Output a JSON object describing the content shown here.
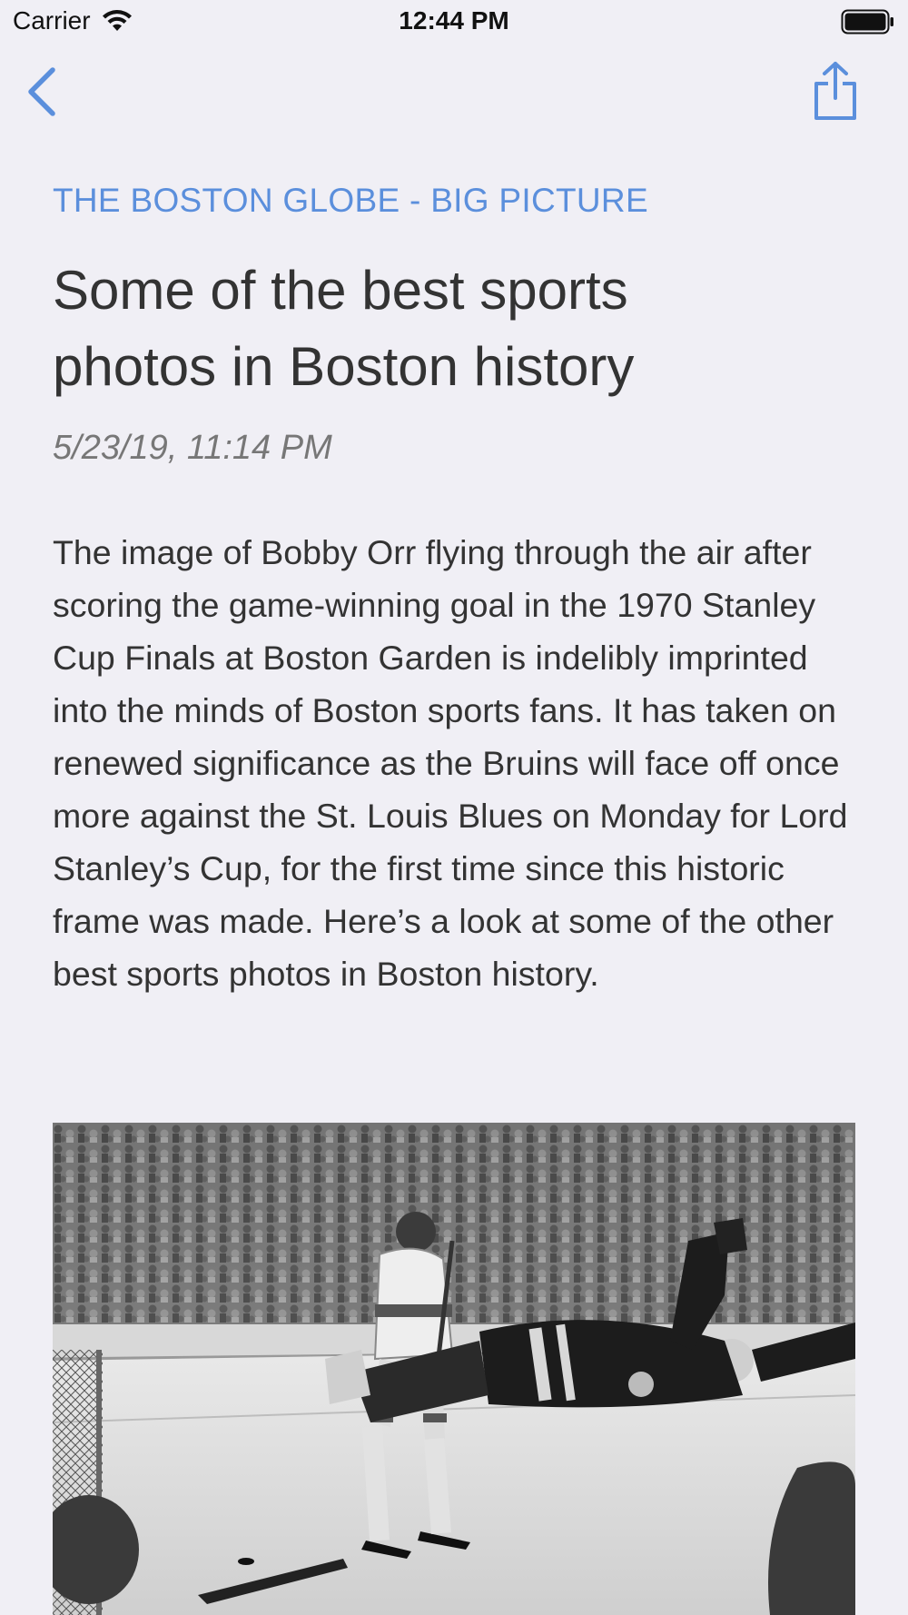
{
  "status_bar": {
    "carrier": "Carrier",
    "time": "12:44 PM"
  },
  "nav": {
    "back_icon": "chevron-left-icon",
    "share_icon": "share-icon",
    "accent_color": "#5b8fdc"
  },
  "article": {
    "source": "THE BOSTON GLOBE - BIG PICTURE",
    "title": "Some of the best sports photos in Boston history",
    "date": "5/23/19, 11:14 PM",
    "body": "The image of Bobby Orr flying through the air after scoring the game-winning goal in the 1970 Stanley Cup Finals at Boston Garden is indelibly imprinted into the minds of Boston sports fans. It has taken on renewed significance as the Bruins will face off once more against the St. Louis Blues on Monday for Lord Stanley’s Cup, for the first time since this historic frame was made. Here’s a look at some of the other best sports photos in Boston history."
  }
}
